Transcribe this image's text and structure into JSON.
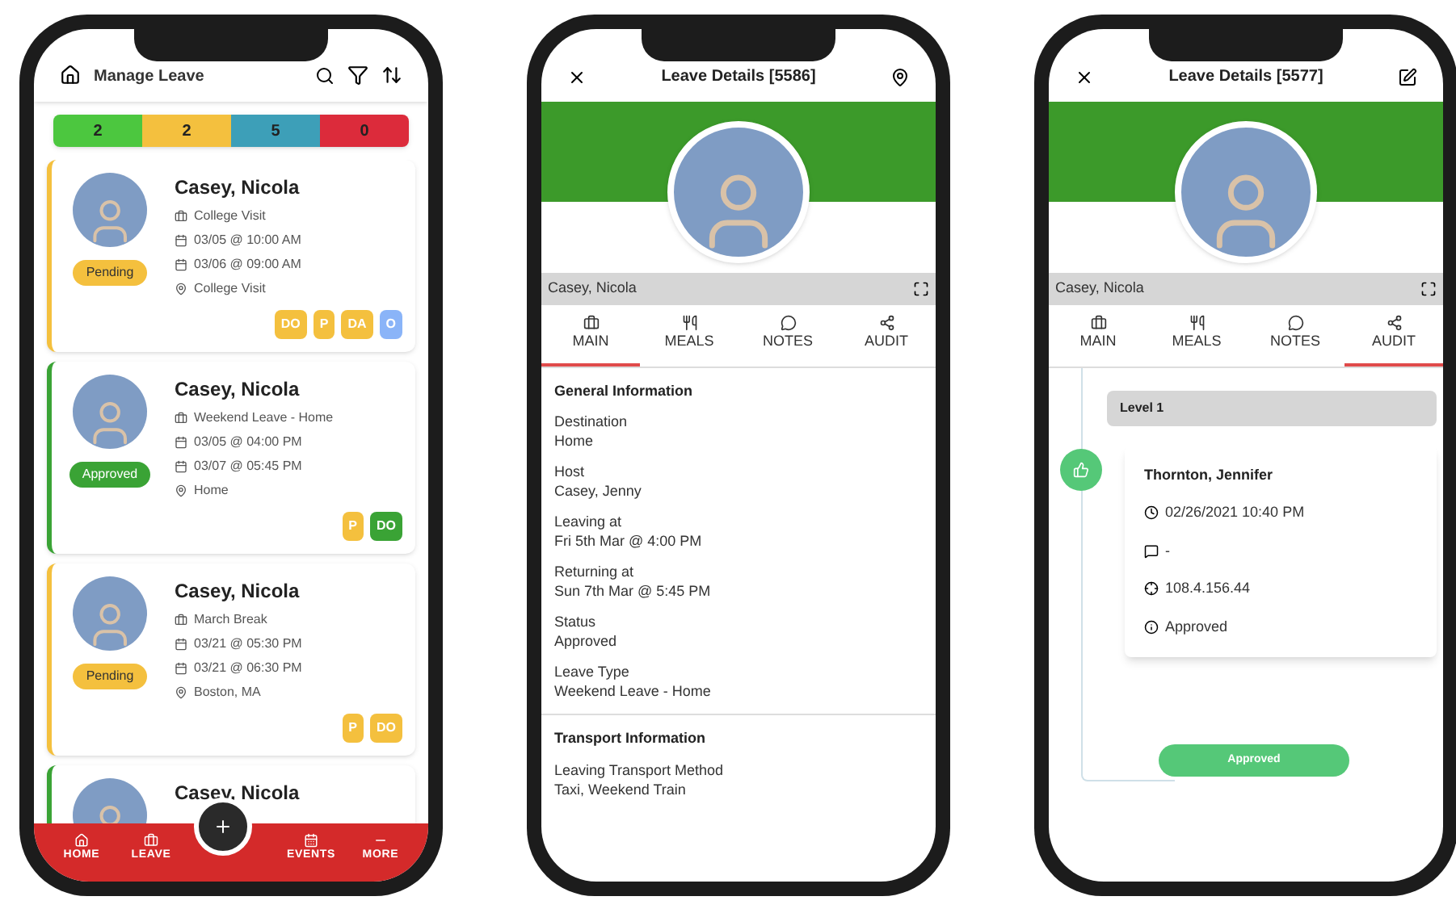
{
  "manage_leave": {
    "title": "Manage Leave",
    "counts": [
      {
        "value": "2",
        "color": "#4cc73f"
      },
      {
        "value": "2",
        "color": "#f4c03e"
      },
      {
        "value": "5",
        "color": "#3d9fb8"
      },
      {
        "value": "0",
        "color": "#dc2b3b"
      }
    ],
    "cards": [
      {
        "name": "Casey, Nicola",
        "leave_type": "College Visit",
        "start": "03/05 @ 10:00 AM",
        "end": "03/06 @ 09:00 AM",
        "location": "College Visit",
        "status": {
          "label": "Pending",
          "kind": "pending"
        },
        "tags": [
          {
            "label": "DO",
            "color": "#f4c03e"
          },
          {
            "label": "P",
            "color": "#f4c03e"
          },
          {
            "label": "DA",
            "color": "#f4c03e"
          },
          {
            "label": "O",
            "color": "#8ab4f8"
          }
        ]
      },
      {
        "name": "Casey, Nicola",
        "leave_type": "Weekend Leave - Home",
        "start": "03/05 @ 04:00 PM",
        "end": "03/07 @ 05:45 PM",
        "location": "Home",
        "status": {
          "label": "Approved",
          "kind": "approved"
        },
        "tags": [
          {
            "label": "P",
            "color": "#f4c03e"
          },
          {
            "label": "DO",
            "color": "#3aa335"
          }
        ]
      },
      {
        "name": "Casey, Nicola",
        "leave_type": "March Break",
        "start": "03/21 @ 05:30 PM",
        "end": "03/21 @ 06:30 PM",
        "location": "Boston, MA",
        "status": {
          "label": "Pending",
          "kind": "pending"
        },
        "tags": [
          {
            "label": "P",
            "color": "#f4c03e"
          },
          {
            "label": "DO",
            "color": "#f4c03e"
          }
        ]
      }
    ],
    "partial_card": {
      "name": "Casey, Nicola",
      "kind": "approved"
    },
    "nav": [
      {
        "label": "HOME"
      },
      {
        "label": "LEAVE"
      },
      {
        "label": "EVENTS"
      },
      {
        "label": "MORE"
      }
    ]
  },
  "leave_details": {
    "title": "Leave Details [5586]",
    "name": "Casey, Nicola",
    "tabs": [
      {
        "label": "MAIN",
        "selected": true
      },
      {
        "label": "MEALS",
        "selected": false
      },
      {
        "label": "NOTES",
        "selected": false
      },
      {
        "label": "AUDIT",
        "selected": false
      }
    ],
    "sections": [
      {
        "heading": "General Information",
        "fields": [
          {
            "label": "Destination",
            "value": "Home"
          },
          {
            "label": "Host",
            "value": "Casey, Jenny"
          },
          {
            "label": "Leaving at",
            "value": "Fri 5th Mar @ 4:00 PM"
          },
          {
            "label": "Returning at",
            "value": "Sun 7th Mar @ 5:45 PM"
          },
          {
            "label": "Status",
            "value": "Approved"
          },
          {
            "label": "Leave Type",
            "value": "Weekend Leave - Home"
          }
        ]
      },
      {
        "heading": "Transport Information",
        "fields": [
          {
            "label": "Leaving Transport Method",
            "value": "Taxi, Weekend Train"
          }
        ]
      }
    ]
  },
  "leave_audit": {
    "title": "Leave Details [5577]",
    "name": "Casey, Nicola",
    "tabs": [
      {
        "label": "MAIN",
        "selected": false
      },
      {
        "label": "MEALS",
        "selected": false
      },
      {
        "label": "NOTES",
        "selected": false
      },
      {
        "label": "AUDIT",
        "selected": true
      }
    ],
    "level": "Level 1",
    "entry": {
      "name": "Thornton, Jennifer",
      "time": "02/26/2021 10:40 PM",
      "comment": "-",
      "ip": "108.4.156.44",
      "status": "Approved"
    },
    "result": "Approved"
  }
}
